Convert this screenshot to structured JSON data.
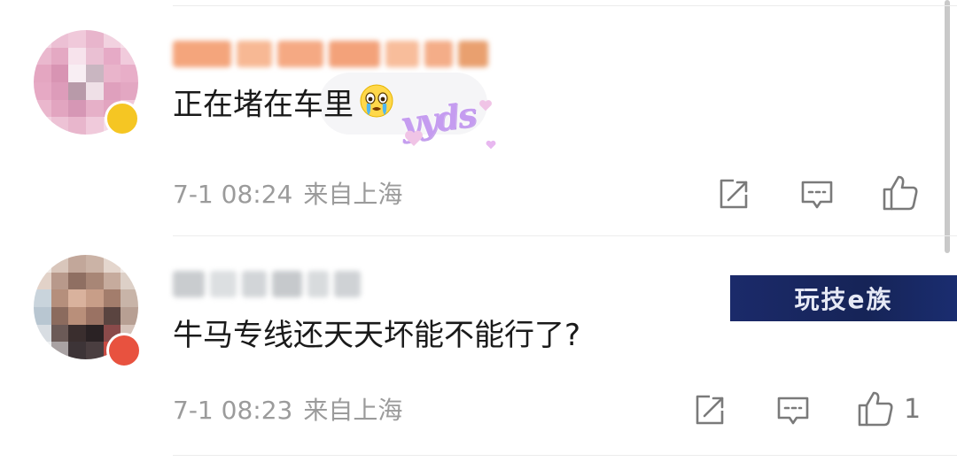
{
  "comments": [
    {
      "text": "正在堵在车里",
      "emoji": "crying-emoji",
      "time": "7-1 08:24",
      "location": "来自上海",
      "likes": ""
    },
    {
      "text": "牛马专线还天天坏能不能行了?",
      "time": "7-1 08:23",
      "location": "来自上海",
      "likes": "1"
    }
  ],
  "sticker": {
    "label": "yyds"
  },
  "watermark": {
    "brand": "玩技e族"
  },
  "icons": {
    "share": "share-icon",
    "reply": "comment-icon",
    "like": "thumbs-up-icon"
  },
  "colors": {
    "text": "#1a1a1a",
    "meta": "#9b9b9b",
    "icon": "#7a7a7a",
    "sticker": "#c59cf0",
    "banner": "#1b2a6a"
  }
}
